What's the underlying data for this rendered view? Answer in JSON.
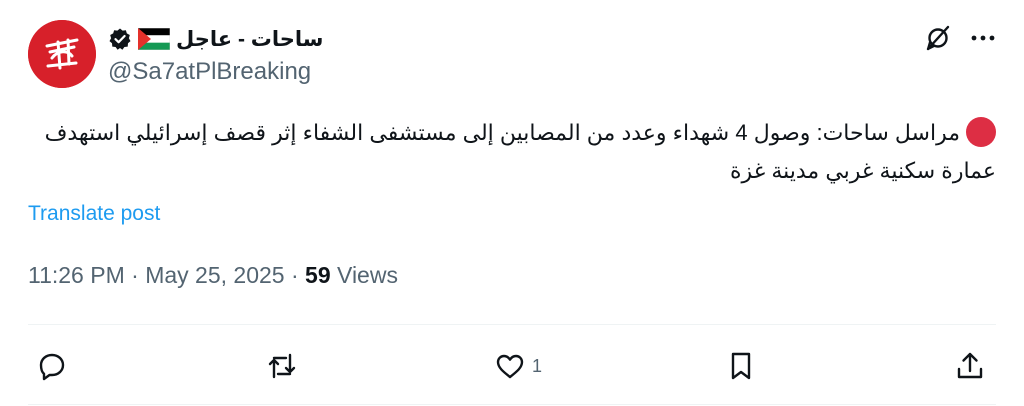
{
  "author": {
    "display_name": "ساحات - عاجل",
    "handle": "@Sa7atPlBreaking",
    "avatar_text": "ساحات",
    "flag_icon": "palestine-flag-icon",
    "verified_icon": "verified-badge-icon"
  },
  "tweet": {
    "text": "مراسل ساحات: وصول 4 شهداء وعدد من المصابين إلى مستشفى الشفاء إثر قصف إسرائيلي استهدف عمارة سكنية غربي مدينة غزة",
    "translate_label": "Translate post",
    "time": "11:26 PM",
    "date": "May 25, 2025",
    "views_count": "59",
    "views_label": "Views"
  },
  "actions": {
    "like_count": "1"
  },
  "colors": {
    "accent": "#1d9bf0",
    "muted": "#536471",
    "avatar_bg": "#d7202a",
    "dot": "#dd2e44"
  }
}
